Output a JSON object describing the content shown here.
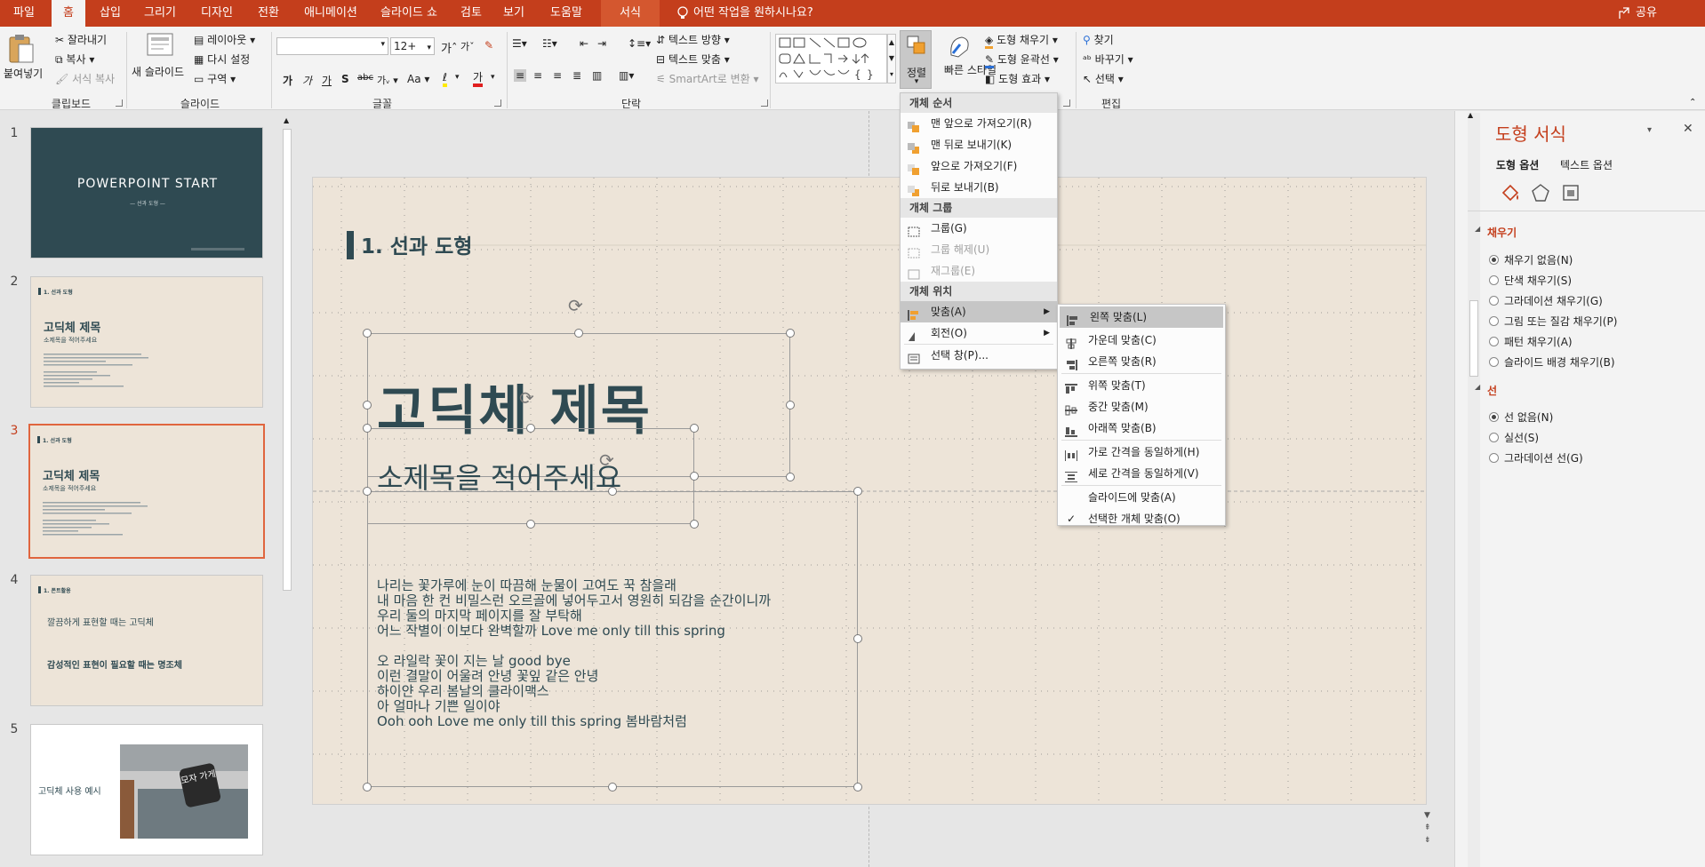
{
  "menubar": {
    "tabs": [
      "파일",
      "홈",
      "삽입",
      "그리기",
      "디자인",
      "전환",
      "애니메이션",
      "슬라이드 쇼",
      "검토",
      "보기",
      "도움말",
      "서식"
    ],
    "tell_me": "어떤 작업을 원하시나요?",
    "share": "공유"
  },
  "ribbon": {
    "clipboard": {
      "paste": "붙여넣기",
      "cut": "잘라내기",
      "copy": "복사",
      "format_painter": "서식 복사",
      "group": "클립보드"
    },
    "slides": {
      "new_slide": "새 슬라이드",
      "layout": "레이아웃",
      "reset": "다시 설정",
      "section": "구역",
      "group": "슬라이드"
    },
    "font": {
      "font_size": "12+",
      "group": "글꼴"
    },
    "paragraph": {
      "text_direction": "텍스트 방향",
      "align_text": "텍스트 맞춤",
      "smartart": "SmartArt로 변환",
      "group": "단락"
    },
    "drawing": {
      "arrange": "정렬",
      "quick_styles": "빠른 스타일",
      "shape_fill": "도형 채우기",
      "shape_outline": "도형 윤곽선",
      "shape_effects": "도형 효과"
    },
    "editing": {
      "find": "찾기",
      "replace": "바꾸기",
      "select": "선택",
      "group": "편집"
    }
  },
  "thumbnails": [
    {
      "num": "1",
      "title": "POWERPOINT START",
      "sub": "— 선과 도형 —"
    },
    {
      "num": "2",
      "heading": "1. 선과 도형",
      "title": "고딕체 제목",
      "sub": "소제목을 적어주세요"
    },
    {
      "num": "3",
      "heading": "1. 선과 도형",
      "title": "고딕체 제목",
      "sub": "소제목을 적어주세요"
    },
    {
      "num": "4",
      "heading": "1. 폰트활용",
      "line1": "깔끔하게 표현할 때는 고딕체",
      "line2": "감성적인 표현이 필요할 때는 명조체"
    },
    {
      "num": "5",
      "label": "고딕체 사용 예시",
      "sign": "모자 가게"
    }
  ],
  "slide": {
    "heading": "1. 선과 도형",
    "title": "고딕체 제목",
    "subtitle": "소제목을 적어주세요",
    "body": [
      "나리는 꽃가루에 눈이 따끔해 눈물이 고여도 꾹 참을래",
      "내 마음 한 컨 비밀스런 오르골에 넣어두고서 영원히 되감을 순간이니까",
      "우리 둘의 마지막 페이지를 잘 부탁해",
      "어느 작별이 이보다 완벽할까 Love me only till this spring",
      "",
      "오 라일락 꽃이 지는 날 good bye",
      "이런 결말이 어울려 안녕 꽃잎 같은 안녕",
      "하이얀 우리 봄날의 클라이맥스",
      "아 얼마나 기쁜 일이야",
      "Ooh ooh Love me only till this spring 봄바람처럼"
    ]
  },
  "arrange_menu": {
    "sections": [
      "개체 순서",
      "개체 그룹",
      "개체 위치"
    ],
    "order": [
      "맨 앞으로 가져오기(R)",
      "맨 뒤로 보내기(K)",
      "앞으로 가져오기(F)",
      "뒤로 보내기(B)"
    ],
    "group": [
      "그룹(G)",
      "그룹 해제(U)",
      "재그룹(E)"
    ],
    "position": [
      "맞춤(A)",
      "회전(O)"
    ],
    "selection_pane": "선택 창(P)..."
  },
  "align_submenu": {
    "items": [
      "왼쪽 맞춤(L)",
      "가운데 맞춤(C)",
      "오른쪽 맞춤(R)",
      "위쪽 맞춤(T)",
      "중간 맞춤(M)",
      "아래쪽 맞춤(B)",
      "가로 간격을 동일하게(H)",
      "세로 간격을 동일하게(V)",
      "슬라이드에 맞춤(A)",
      "선택한 개체 맞춤(O)"
    ],
    "checked": "선택한 개체 맞춤(O)"
  },
  "format_pane": {
    "title": "도형 서식",
    "tabs": [
      "도형 옵션",
      "텍스트 옵션"
    ],
    "fill_section": "채우기",
    "fill_options": [
      "채우기 없음(N)",
      "단색 채우기(S)",
      "그라데이션 채우기(G)",
      "그림 또는 질감 채우기(P)",
      "패턴 채우기(A)",
      "슬라이드 배경 채우기(B)"
    ],
    "fill_selected": "채우기 없음(N)",
    "line_section": "선",
    "line_options": [
      "선 없음(N)",
      "실선(S)",
      "그라데이션 선(G)"
    ],
    "line_selected": "선 없음(N)"
  },
  "colors": {
    "accent": "#c43e1c",
    "slide_bg": "#ede4d8",
    "title_text": "#2f4a52",
    "dark_slide": "#2f4a52"
  }
}
